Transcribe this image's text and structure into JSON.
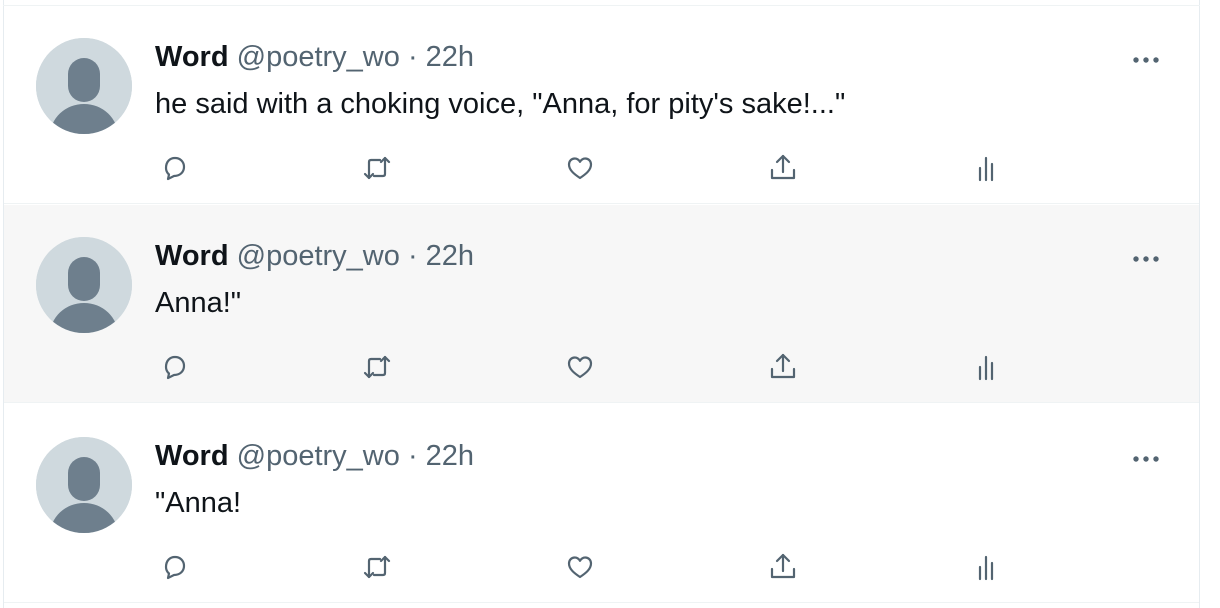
{
  "tweets": [
    {
      "name": "Word",
      "handle": "@poetry_wo",
      "separator": "·",
      "time": "22h",
      "text": "he said with a choking voice, \"Anna, for pity's sake!...\"",
      "hovered": false
    },
    {
      "name": "Word",
      "handle": "@poetry_wo",
      "separator": "·",
      "time": "22h",
      "text": "Anna!\"",
      "hovered": true
    },
    {
      "name": "Word",
      "handle": "@poetry_wo",
      "separator": "·",
      "time": "22h",
      "text": "\"Anna!",
      "hovered": false
    }
  ],
  "icons": {
    "reply": "reply-icon",
    "retweet": "retweet-icon",
    "like": "like-icon",
    "share": "share-icon",
    "analytics": "analytics-icon",
    "more": "more-icon"
  },
  "colors": {
    "text_primary": "#0f1419",
    "text_secondary": "#536471",
    "avatar_bg": "#cfd9de",
    "avatar_fg": "#6e7f8d",
    "hover_bg": "#f7f7f7"
  }
}
